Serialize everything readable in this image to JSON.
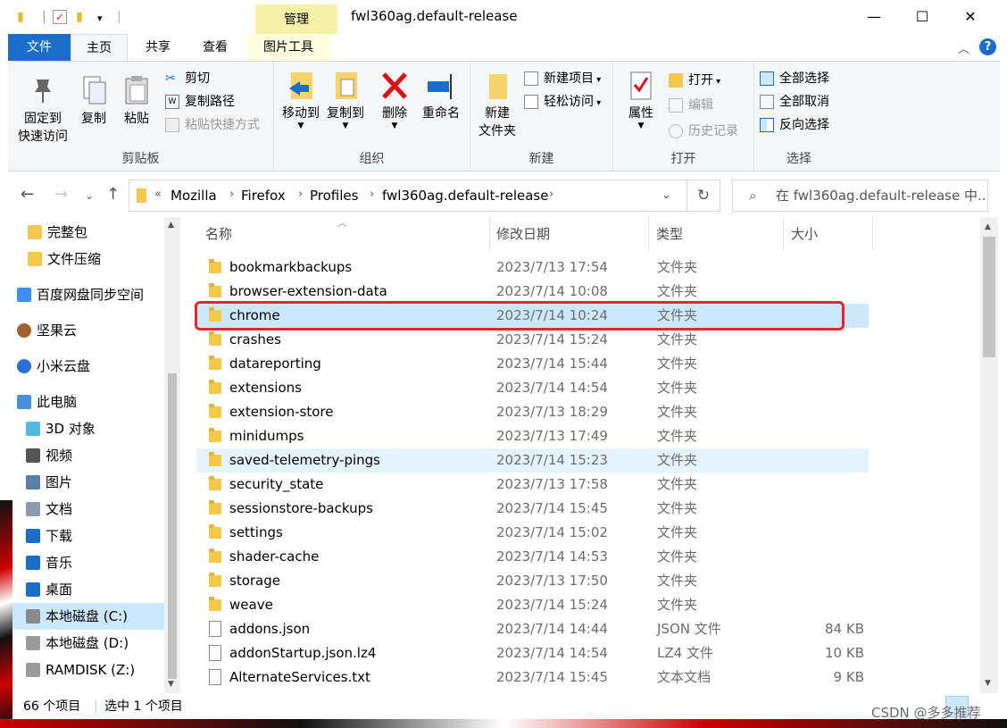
{
  "window": {
    "title": "fwl360ag.default-release",
    "context_tab": "管理",
    "controls": {
      "minimize": "—",
      "maximize": "☐",
      "close": "✕"
    }
  },
  "tabs": [
    "文件",
    "主页",
    "共享",
    "查看",
    "图片工具"
  ],
  "ribbon": {
    "clipboard": {
      "label": "剪贴板",
      "pin_line1": "固定到",
      "pin_line2": "快速访问",
      "copy": "复制",
      "paste": "粘贴",
      "cut": "剪切",
      "copy_path": "复制路径",
      "paste_shortcut": "粘贴快捷方式"
    },
    "organize": {
      "label": "组织",
      "move_to": "移动到",
      "copy_to": "复制到",
      "delete": "删除",
      "rename": "重命名"
    },
    "new": {
      "label": "新建",
      "new_folder_line1": "新建",
      "new_folder_line2": "文件夹",
      "new_item": "新建项目",
      "easy_access": "轻松访问"
    },
    "open": {
      "label": "打开",
      "properties": "属性",
      "open": "打开",
      "edit": "编辑",
      "history": "历史记录"
    },
    "select": {
      "label": "选择",
      "select_all": "全部选择",
      "select_none": "全部取消",
      "invert": "反向选择"
    }
  },
  "address": {
    "overflow": "«",
    "crumbs": [
      "Mozilla",
      "Firefox",
      "Profiles",
      "fwl360ag.default-release"
    ],
    "search_placeholder": "在 fwl360ag.default-release 中..."
  },
  "nav_pane": [
    {
      "label": "完整包",
      "icon": "folder-icon"
    },
    {
      "label": "文件压缩",
      "icon": "folder-icon"
    },
    {
      "label": "百度网盘同步空间",
      "icon": "baidu-cloud-icon"
    },
    {
      "label": "坚果云",
      "icon": "nutstore-icon"
    },
    {
      "label": "小米云盘",
      "icon": "mi-cloud-icon"
    },
    {
      "label": "此电脑",
      "icon": "computer-icon"
    },
    {
      "label": "3D 对象",
      "icon": "3d-objects-icon"
    },
    {
      "label": "视频",
      "icon": "video-icon"
    },
    {
      "label": "图片",
      "icon": "pictures-icon"
    },
    {
      "label": "文档",
      "icon": "documents-icon"
    },
    {
      "label": "下载",
      "icon": "download-icon"
    },
    {
      "label": "音乐",
      "icon": "music-icon"
    },
    {
      "label": "桌面",
      "icon": "desktop-icon"
    },
    {
      "label": "本地磁盘 (C:)",
      "icon": "drive-c-icon"
    },
    {
      "label": "本地磁盘 (D:)",
      "icon": "drive-icon"
    },
    {
      "label": "RAMDISK (Z:)",
      "icon": "drive-icon"
    }
  ],
  "columns": {
    "name": "名称",
    "modified": "修改日期",
    "type": "类型",
    "size": "大小"
  },
  "files": [
    {
      "name": "bookmarkbackups",
      "modified": "2023/7/13 17:54",
      "type": "文件夹",
      "size": "",
      "kind": "folder"
    },
    {
      "name": "browser-extension-data",
      "modified": "2023/7/14 10:08",
      "type": "文件夹",
      "size": "",
      "kind": "folder"
    },
    {
      "name": "chrome",
      "modified": "2023/7/14 10:24",
      "type": "文件夹",
      "size": "",
      "kind": "folder",
      "state": "selected"
    },
    {
      "name": "crashes",
      "modified": "2023/7/14 15:24",
      "type": "文件夹",
      "size": "",
      "kind": "folder"
    },
    {
      "name": "datareporting",
      "modified": "2023/7/14 15:44",
      "type": "文件夹",
      "size": "",
      "kind": "folder"
    },
    {
      "name": "extensions",
      "modified": "2023/7/14 14:54",
      "type": "文件夹",
      "size": "",
      "kind": "folder"
    },
    {
      "name": "extension-store",
      "modified": "2023/7/13 18:29",
      "type": "文件夹",
      "size": "",
      "kind": "folder"
    },
    {
      "name": "minidumps",
      "modified": "2023/7/13 17:49",
      "type": "文件夹",
      "size": "",
      "kind": "folder"
    },
    {
      "name": "saved-telemetry-pings",
      "modified": "2023/7/14 15:23",
      "type": "文件夹",
      "size": "",
      "kind": "folder",
      "state": "hover"
    },
    {
      "name": "security_state",
      "modified": "2023/7/13 17:58",
      "type": "文件夹",
      "size": "",
      "kind": "folder"
    },
    {
      "name": "sessionstore-backups",
      "modified": "2023/7/14 15:45",
      "type": "文件夹",
      "size": "",
      "kind": "folder"
    },
    {
      "name": "settings",
      "modified": "2023/7/14 15:02",
      "type": "文件夹",
      "size": "",
      "kind": "folder"
    },
    {
      "name": "shader-cache",
      "modified": "2023/7/14 14:53",
      "type": "文件夹",
      "size": "",
      "kind": "folder"
    },
    {
      "name": "storage",
      "modified": "2023/7/13 17:50",
      "type": "文件夹",
      "size": "",
      "kind": "folder"
    },
    {
      "name": "weave",
      "modified": "2023/7/14 15:24",
      "type": "文件夹",
      "size": "",
      "kind": "folder"
    },
    {
      "name": "addons.json",
      "modified": "2023/7/14 14:44",
      "type": "JSON 文件",
      "size": "84 KB",
      "kind": "file"
    },
    {
      "name": "addonStartup.json.lz4",
      "modified": "2023/7/14 14:54",
      "type": "LZ4 文件",
      "size": "10 KB",
      "kind": "file"
    },
    {
      "name": "AlternateServices.txt",
      "modified": "2023/7/14 15:45",
      "type": "文本文档",
      "size": "9 KB",
      "kind": "file"
    }
  ],
  "status": {
    "count": "66 个项目",
    "selected": "选中 1 个项目"
  },
  "watermark": "CSDN @多多推荐",
  "colors": {
    "accent": "#1a6ec7",
    "selection": "#cce8ff",
    "highlight_box": "#e8252a",
    "context_tab": "#f6f1a8"
  }
}
